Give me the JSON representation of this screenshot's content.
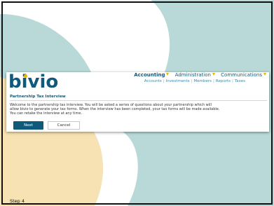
{
  "brand": {
    "logo_text": "bivio"
  },
  "nav": {
    "primary": [
      "Accounting",
      "Administration",
      "Communications"
    ],
    "secondary": [
      "Accounts",
      "Investments",
      "Members",
      "Reports",
      "Taxes"
    ]
  },
  "interview": {
    "title": "Partnership Tax Interview",
    "body": "Welcome to the partnership tax interview. You will be asked a series of questions about your partnership which will allow bivio to generate your tax forms. When the interview has been completed, your tax forms will be made available. You can retake the interview at any time.",
    "next_label": "Next",
    "cancel_label": "Cancel"
  },
  "step": {
    "label": "Step 4"
  },
  "colors": {
    "brand_blue": "#0f5a7a",
    "accent_yellow": "#f0b400",
    "bg_teal": "#b9d9d9",
    "bg_cream": "#f7e2b4"
  }
}
